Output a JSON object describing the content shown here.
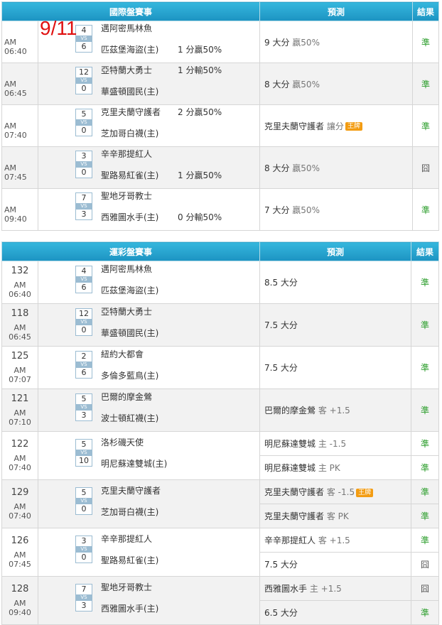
{
  "date_label": "9/11",
  "intl": {
    "headers": [
      "國際盤賽事",
      "預測",
      "結果"
    ],
    "rows": [
      {
        "time": "AM 06:40",
        "away": "邁阿密馬林魚",
        "home": "匹茲堡海盜(主)",
        "s1": "4",
        "s2": "6",
        "hc": "1 分贏50%",
        "hc_row": 2,
        "pred": "9 大分",
        "pred_g": "贏50%",
        "badge": "",
        "res": "準",
        "lose": false
      },
      {
        "time": "AM 06:45",
        "away": "亞特蘭大勇士",
        "home": "華盛頓國民(主)",
        "s1": "12",
        "s2": "0",
        "hc": "1 分輸50%",
        "hc_row": 1,
        "pred": "8 大分",
        "pred_g": "贏50%",
        "badge": "",
        "res": "準",
        "lose": false
      },
      {
        "time": "AM 07:40",
        "away": "克里夫蘭守護者",
        "home": "芝加哥白襪(主)",
        "s1": "5",
        "s2": "0",
        "hc": "2 分贏50%",
        "hc_row": 1,
        "pred": "克里夫蘭守護者",
        "pred_g": "讓分",
        "badge": "王牌",
        "res": "準",
        "lose": false
      },
      {
        "time": "AM 07:45",
        "away": "辛辛那提紅人",
        "home": "聖路易紅雀(主)",
        "s1": "3",
        "s2": "0",
        "hc": "1 分贏50%",
        "hc_row": 2,
        "pred": "8 大分",
        "pred_g": "贏50%",
        "badge": "",
        "res": "囧",
        "lose": true
      },
      {
        "time": "AM 09:40",
        "away": "聖地牙哥教士",
        "home": "西雅圖水手(主)",
        "s1": "7",
        "s2": "3",
        "hc": "0 分輸50%",
        "hc_row": 2,
        "pred": "7 大分",
        "pred_g": "贏50%",
        "badge": "",
        "res": "準",
        "lose": false
      }
    ]
  },
  "lottery": {
    "headers": [
      "運彩盤賽事",
      "預測",
      "結果"
    ],
    "rows": [
      {
        "num": "132",
        "time": "AM 06:40",
        "away": "邁阿密馬林魚",
        "home": "匹茲堡海盜(主)",
        "s1": "4",
        "s2": "6",
        "preds": [
          {
            "t": "8.5 大分",
            "g": "",
            "badge": "",
            "res": "準",
            "lose": false
          }
        ]
      },
      {
        "num": "118",
        "time": "AM 06:45",
        "away": "亞特蘭大勇士",
        "home": "華盛頓國民(主)",
        "s1": "12",
        "s2": "0",
        "preds": [
          {
            "t": "7.5 大分",
            "g": "",
            "badge": "",
            "res": "準",
            "lose": false
          }
        ]
      },
      {
        "num": "125",
        "time": "AM 07:07",
        "away": "紐約大都會",
        "home": "多倫多藍鳥(主)",
        "s1": "2",
        "s2": "6",
        "preds": [
          {
            "t": "7.5 大分",
            "g": "",
            "badge": "",
            "res": "準",
            "lose": false
          }
        ]
      },
      {
        "num": "121",
        "time": "AM 07:10",
        "away": "巴爾的摩金鶯",
        "home": "波士頓紅襪(主)",
        "s1": "5",
        "s2": "3",
        "preds": [
          {
            "t": "巴爾的摩金鶯",
            "g": "客 +1.5",
            "badge": "",
            "res": "準",
            "lose": false
          }
        ]
      },
      {
        "num": "122",
        "time": "AM 07:40",
        "away": "洛杉磯天使",
        "home": "明尼蘇達雙城(主)",
        "s1": "5",
        "s2": "10",
        "preds": [
          {
            "t": "明尼蘇達雙城",
            "g": "主 -1.5",
            "badge": "",
            "res": "準",
            "lose": false
          },
          {
            "t": "明尼蘇達雙城",
            "g": "主 PK",
            "badge": "",
            "res": "準",
            "lose": false
          }
        ]
      },
      {
        "num": "129",
        "time": "AM 07:40",
        "away": "克里夫蘭守護者",
        "home": "芝加哥白襪(主)",
        "s1": "5",
        "s2": "0",
        "preds": [
          {
            "t": "克里夫蘭守護者",
            "g": "客 -1.5",
            "badge": "王牌",
            "res": "準",
            "lose": false
          },
          {
            "t": "克里夫蘭守護者",
            "g": "客 PK",
            "badge": "",
            "res": "準",
            "lose": false
          }
        ]
      },
      {
        "num": "126",
        "time": "AM 07:45",
        "away": "辛辛那提紅人",
        "home": "聖路易紅雀(主)",
        "s1": "3",
        "s2": "0",
        "preds": [
          {
            "t": "辛辛那提紅人",
            "g": "客 +1.5",
            "badge": "",
            "res": "準",
            "lose": false
          },
          {
            "t": "7.5 大分",
            "g": "",
            "badge": "",
            "res": "囧",
            "lose": true
          }
        ]
      },
      {
        "num": "128",
        "time": "AM 09:40",
        "away": "聖地牙哥教士",
        "home": "西雅圖水手(主)",
        "s1": "7",
        "s2": "3",
        "preds": [
          {
            "t": "西雅圖水手",
            "g": "主 +1.5",
            "badge": "",
            "res": "囧",
            "lose": true
          },
          {
            "t": "6.5 大分",
            "g": "",
            "badge": "",
            "res": "準",
            "lose": false
          }
        ]
      }
    ]
  }
}
